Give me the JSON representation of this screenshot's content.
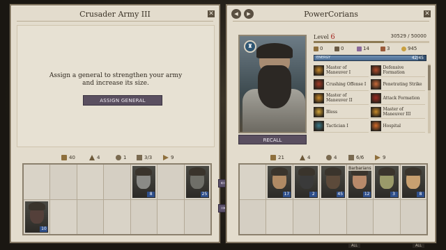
{
  "left_panel": {
    "title": "Crusader Army III",
    "assign_text_line1": "Assign a general to strengthen your army",
    "assign_text_line2": "and increase its size.",
    "assign_button": "ASSIGN GENERAL",
    "stats": [
      {
        "icon": "leadership-icon",
        "value": "40"
      },
      {
        "icon": "attack-icon",
        "value": "4"
      },
      {
        "icon": "unit-icon",
        "value": "1"
      },
      {
        "icon": "squads-icon",
        "value": "3/3"
      },
      {
        "icon": "speed-icon",
        "value": "9"
      }
    ],
    "units": [
      {
        "cell": 4,
        "count": "8",
        "tone": "#8a8a86"
      },
      {
        "cell": 6,
        "count": "25",
        "tone": "#6f6f68"
      },
      {
        "cell": 7,
        "count": "10",
        "tone": "#54403a"
      }
    ]
  },
  "right_panel": {
    "title": "PowerCorians",
    "level_label": "Level",
    "level_value": "6",
    "xp_text": "30529 / 50000",
    "xp_fraction": 0.61,
    "resources": [
      {
        "icon": "gold-icon",
        "value": "0"
      },
      {
        "icon": "sword-icon",
        "value": "0"
      },
      {
        "icon": "crystal-icon",
        "value": "14"
      },
      {
        "icon": "flag-icon",
        "value": "3"
      },
      {
        "icon": "coin-stack-icon",
        "value": "945"
      }
    ],
    "energy_label": "ENERGY",
    "energy_value": "42/45",
    "energy_fraction": 0.93,
    "recall_button": "RECALL",
    "skills": [
      {
        "label": "Master of Maneuver I",
        "color": "#c98a2a"
      },
      {
        "label": "Defensive Formation",
        "color": "#b14a2a"
      },
      {
        "label": "Crushing Offense I",
        "color": "#a33a26"
      },
      {
        "label": "Penetrating Strike",
        "color": "#c76a3a"
      },
      {
        "label": "Master of Maneuver II",
        "color": "#c98a2a"
      },
      {
        "label": "Attack Formation",
        "color": "#9e2a22"
      },
      {
        "label": "Bless",
        "color": "#d6a83a"
      },
      {
        "label": "Master of Maneuver III",
        "color": "#c98a2a"
      },
      {
        "label": "Tactician I",
        "color": "#3a7a8a"
      },
      {
        "label": "Hospital",
        "color": "#d26a2a"
      }
    ],
    "stats": [
      {
        "icon": "leadership-icon",
        "value": "21"
      },
      {
        "icon": "attack-icon",
        "value": "4"
      },
      {
        "icon": "unit-icon",
        "value": "4"
      },
      {
        "icon": "squads-icon",
        "value": "6/6"
      },
      {
        "icon": "speed-icon",
        "value": "9"
      }
    ],
    "units": [
      {
        "cell": 1,
        "count": "17",
        "tone": "#b08a64",
        "caption": ""
      },
      {
        "cell": 2,
        "count": "2",
        "tone": "#3a3a3a",
        "caption": ""
      },
      {
        "cell": 3,
        "count": "45",
        "tone": "#5c4a3a",
        "caption": ""
      },
      {
        "cell": 4,
        "count": "12",
        "tone": "#b88a6a",
        "caption": "Barbarians"
      },
      {
        "cell": 5,
        "count": "3",
        "tone": "#9a9a6a",
        "caption": ""
      },
      {
        "cell": 6,
        "count": "8",
        "tone": "#c8a070",
        "caption": ""
      }
    ]
  },
  "footer": {
    "left": "ALL",
    "right": "ALL"
  }
}
